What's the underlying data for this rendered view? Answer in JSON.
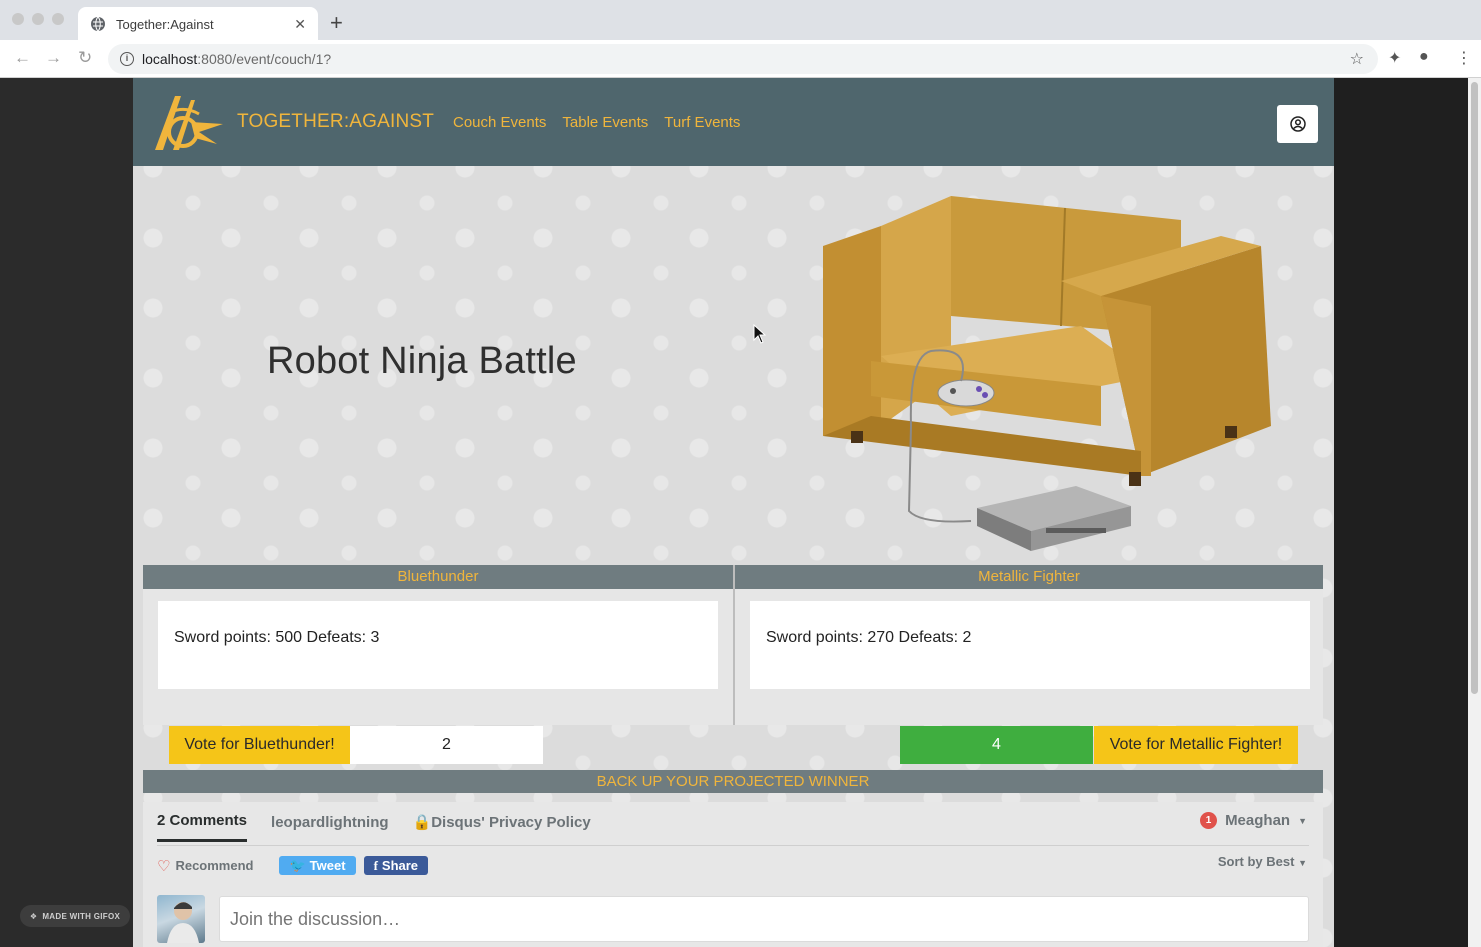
{
  "browser": {
    "tab_title": "Together:Against",
    "url_host": "localhost",
    "url_path": ":8080/event/couch/1?"
  },
  "header": {
    "brand": "TOGETHER:AGAINST",
    "nav": [
      "Couch Events",
      "Table Events",
      "Turf Events"
    ]
  },
  "event": {
    "title": "Robot Ninja Battle"
  },
  "competitors": [
    {
      "name": "Bluethunder",
      "stats": "Sword points: 500 Defeats: 3",
      "vote_label": "Vote for Bluethunder!",
      "votes": "2"
    },
    {
      "name": "Metallic Fighter",
      "stats": "Sword points: 270 Defeats: 2",
      "vote_label": "Vote for Metallic Fighter!",
      "votes": "4"
    }
  ],
  "backup_banner": "BACK UP YOUR PROJECTED WINNER",
  "disqus": {
    "tabs": [
      "2 Comments",
      "leopardlightning",
      "Disqus' Privacy Policy"
    ],
    "user_name": "Meaghan",
    "notification_count": "1",
    "recommend": "Recommend",
    "tweet": "Tweet",
    "share": "Share",
    "sort": "Sort by Best",
    "input_placeholder": "Join the discussion…"
  },
  "watermark": "MADE WITH GIFOX",
  "colors": {
    "header_bg": "#4f666d",
    "brand_gold": "#f0b53c",
    "vote_yellow": "#f5c518",
    "leader_green": "#3fae3f"
  }
}
